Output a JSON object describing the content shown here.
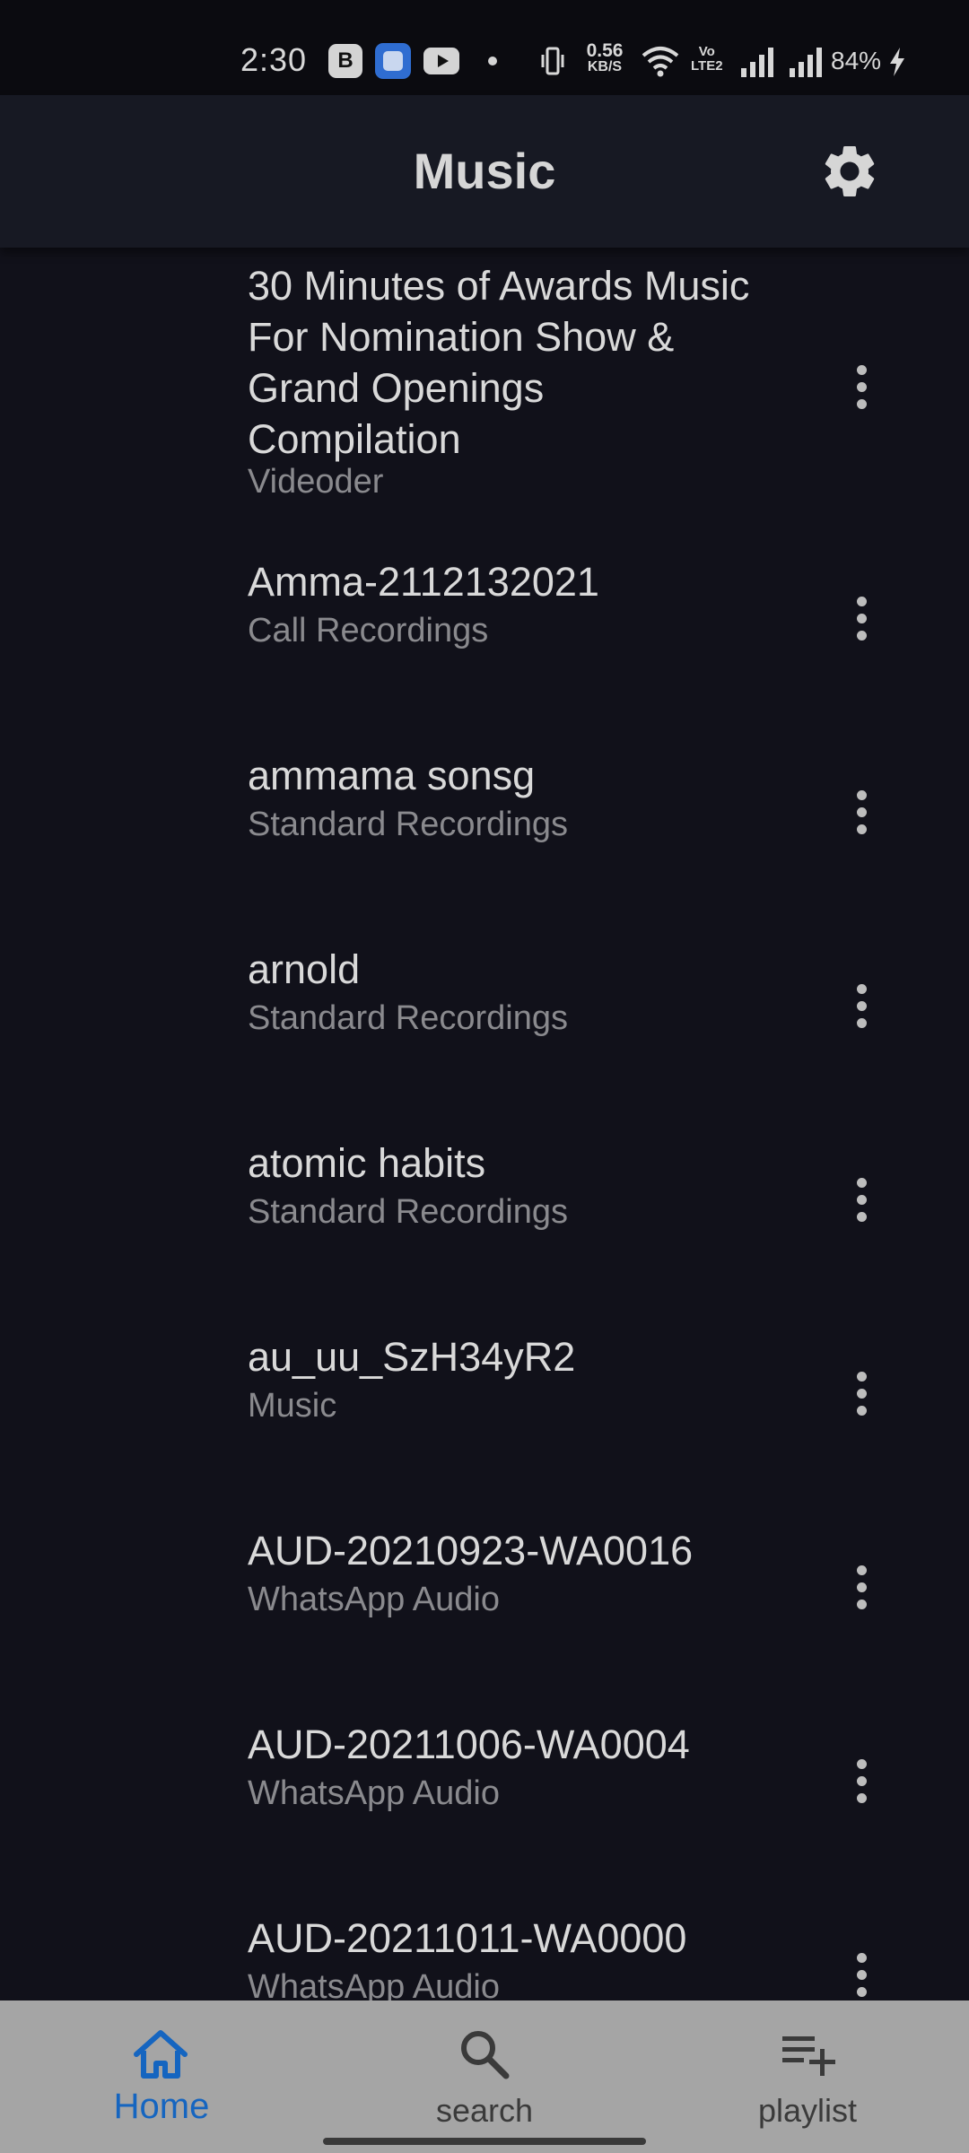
{
  "status_bar": {
    "time": "2:30",
    "notification_b_label": "B",
    "net_speed_value": "0.56",
    "net_speed_unit": "KB/S",
    "volte_label": "Vo",
    "lte_label": "LTE2",
    "battery_percent": "84%"
  },
  "app_bar": {
    "title": "Music",
    "settings_icon": "gear-icon"
  },
  "tracks": [
    {
      "title": "30 Minutes of Awards Music For Nomination Show & Grand Openings Compilation",
      "subtitle": "Videoder"
    },
    {
      "title": "Amma-2112132021",
      "subtitle": "Call Recordings"
    },
    {
      "title": "ammama sonsg",
      "subtitle": "Standard Recordings"
    },
    {
      "title": "arnold",
      "subtitle": "Standard Recordings"
    },
    {
      "title": "atomic habits",
      "subtitle": "Standard Recordings"
    },
    {
      "title": "au_uu_SzH34yR2",
      "subtitle": "Music"
    },
    {
      "title": "AUD-20210923-WA0016",
      "subtitle": "WhatsApp Audio"
    },
    {
      "title": "AUD-20211006-WA0004",
      "subtitle": "WhatsApp Audio"
    },
    {
      "title": "AUD-20211011-WA0000",
      "subtitle": "WhatsApp Audio"
    }
  ],
  "bottom_nav": {
    "home_label": "Home",
    "search_label": "search",
    "playlist_label": "playlist",
    "active": "Home",
    "active_color": "#1565c0",
    "inactive_color": "#3a3a3a"
  }
}
